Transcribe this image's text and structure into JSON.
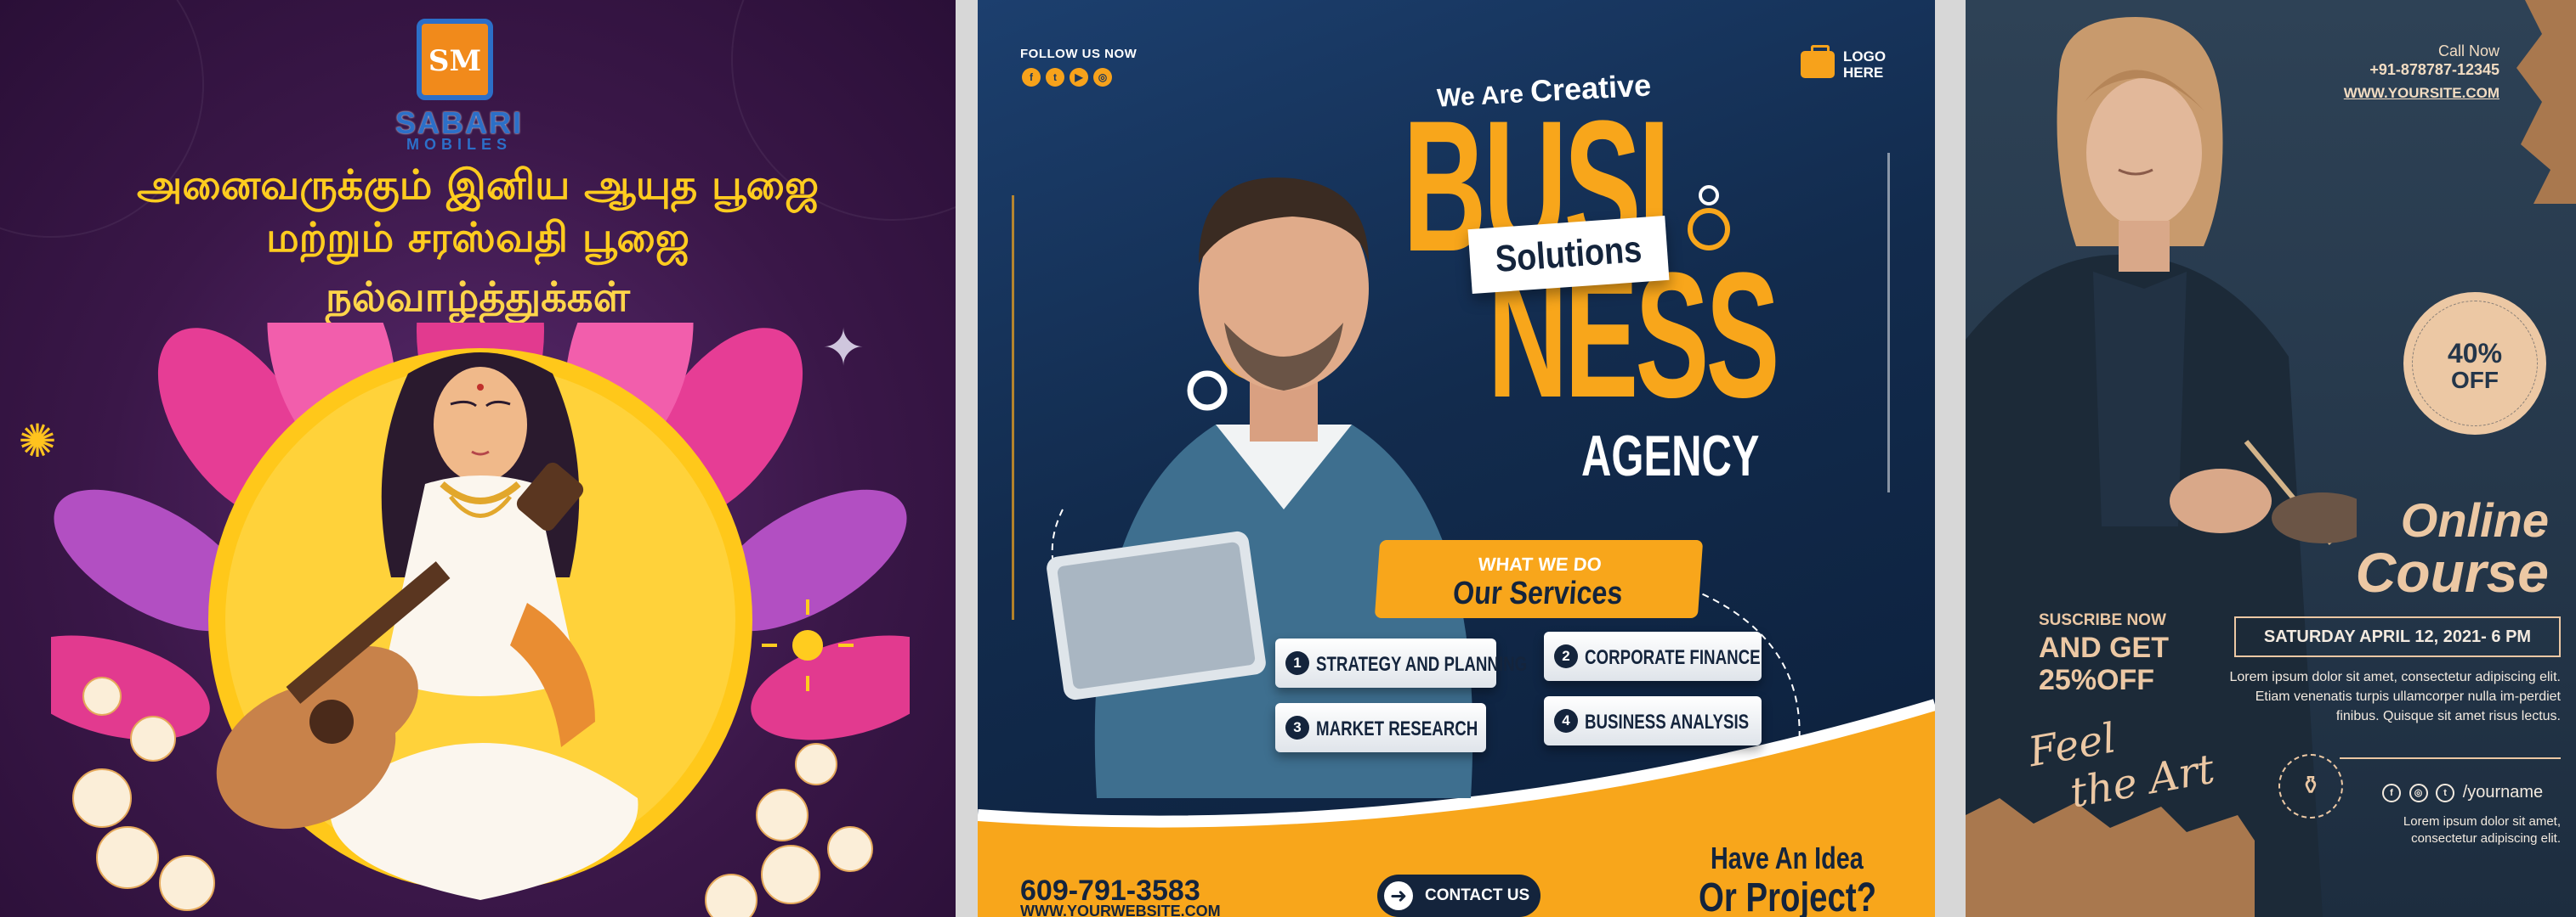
{
  "panel_tamil": {
    "logo_monogram": "SM",
    "brand_name": "SABARI",
    "brand_sub": "MOBILES",
    "greeting_lines": [
      "அனைவருக்கும் இனிய ஆயுத பூஜை",
      "மற்றும் சரஸ்வதி பூஜை",
      "நல்வாழ்த்துக்கள்"
    ],
    "colors": {
      "background": "#3a1748",
      "headline": "#ffcc1f",
      "brand": "#2c6fc8",
      "logo_fill": "#f18a1b"
    }
  },
  "panel_business": {
    "follow_label": "FOLLOW US NOW",
    "social_icons": [
      "facebook-icon",
      "twitter-icon",
      "youtube-icon",
      "instagram-icon"
    ],
    "logo_label_line1": "LOGO",
    "logo_label_line2": "HERE",
    "tagline_prefix": "We Are",
    "tagline_word": "Creative",
    "headline_top": "BUSI",
    "headline_bottom": "NESS",
    "solutions_label": "Solutions",
    "agency_label": "AGENCY",
    "services_kicker": "WHAT WE DO",
    "services_title": "Our Services",
    "services": [
      {
        "num": "1",
        "label": "STRATEGY AND PLANNING"
      },
      {
        "num": "2",
        "label": "CORPORATE FINANCE"
      },
      {
        "num": "3",
        "label": "MARKET RESEARCH"
      },
      {
        "num": "4",
        "label": "BUSINESS ANALYSIS"
      }
    ],
    "phone": "609-791-3583",
    "website": "WWW.YOURWEBSITE.COM",
    "contact_button": "CONTACT US",
    "idea_line1": "Have An Idea",
    "idea_line2": "Or Project?",
    "colors": {
      "accent": "#f8a61b",
      "dark": "#14243c",
      "background": "#1c3f6e"
    }
  },
  "panel_course": {
    "call_label": "Call Now",
    "phone": "+91-878787-12345",
    "website": "WWW.YOURSITE.COM",
    "badge_percent": "40%",
    "badge_off": "OFF",
    "title_line1": "Online",
    "title_line2": "Course",
    "date": "SATURDAY APRIL 12, 2021- 6 PM",
    "description": "Lorem ipsum dolor sit amet, consectetur adipiscing elit. Etiam venenatis turpis ullamcorper nulla im-perdiet finibus. Quisque sit amet risus lectus.",
    "subscribe_label": "SUSCRIBE NOW",
    "offer_line1": "AND GET",
    "offer_line2": "25%OFF",
    "script_line1": "Feel",
    "script_line2": "the Art",
    "social_handle": "/yourname",
    "social_icons": [
      "facebook-icon",
      "instagram-icon",
      "twitter-icon"
    ],
    "footer_text": "Lorem ipsum dolor sit amet, consectetur adipiscing elit.",
    "colors": {
      "background": "#2e4256",
      "accent": "#ecc8a4"
    }
  }
}
